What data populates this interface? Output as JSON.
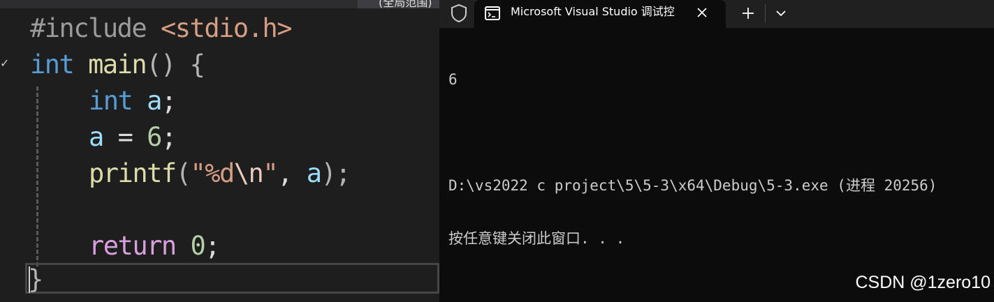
{
  "editor": {
    "tab_fragment": "(全局范围)",
    "code": {
      "line1": {
        "directive": "#include",
        "header": "<stdio.h>"
      },
      "line2": {
        "type": "int",
        "name": "main",
        "parens": "()",
        "brace": "{"
      },
      "line3": {
        "type": "int",
        "var": "a",
        "semi": ";"
      },
      "line4": {
        "var": "a",
        "op": "=",
        "num": "6",
        "semi": ";"
      },
      "line5": {
        "fn": "printf",
        "open": "(",
        "q1": "\"",
        "fmt": "%d",
        "esc": "\\n",
        "q2": "\"",
        "comma": ",",
        "var": "a",
        "close": ");"
      },
      "line7": {
        "kw": "return",
        "num": "0",
        "semi": ";"
      },
      "line8": {
        "brace": "}"
      }
    }
  },
  "terminal": {
    "tab_title": "Microsoft Visual Studio 调试控",
    "icons": {
      "shield": "shield-icon",
      "tab": "terminal-icon",
      "close": "close-icon",
      "new_tab": "plus-icon",
      "dropdown": "chevron-down-icon"
    },
    "output": [
      "6",
      "",
      "D:\\vs2022 c project\\5\\5-3\\x64\\Debug\\5-3.exe (进程 20256)",
      "按任意键关闭此窗口. . ."
    ]
  },
  "watermark": "CSDN @1zero10"
}
